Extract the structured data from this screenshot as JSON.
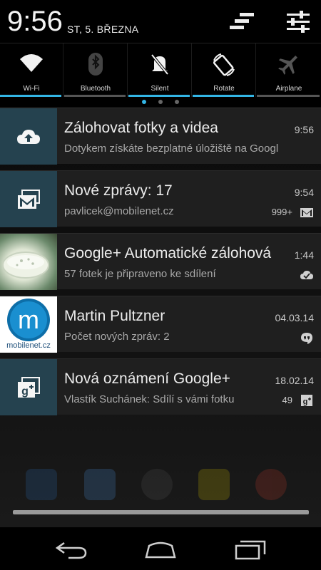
{
  "status": {
    "time": "9:56",
    "date": "ST, 5. BŘEZNA"
  },
  "quick_settings": [
    {
      "label": "Wi-Fi",
      "icon": "wifi-icon",
      "active": true
    },
    {
      "label": "Bluetooth",
      "icon": "bluetooth-icon",
      "active": false
    },
    {
      "label": "Silent",
      "icon": "silent-icon",
      "active": true
    },
    {
      "label": "Rotate",
      "icon": "rotate-icon",
      "active": true
    },
    {
      "label": "Airplane",
      "icon": "airplane-icon",
      "active": false
    }
  ],
  "pager": {
    "pages": 3,
    "active": 0
  },
  "notifications": [
    {
      "title": "Zálohovat fotky a videa",
      "subtitle": "Dotykem získáte bezplatné úložiště na Googl",
      "time": "9:56",
      "icon": "upload-cloud-icon"
    },
    {
      "title": "Nové zprávy: 17",
      "subtitle": "pavlicek@mobilenet.cz",
      "time": "9:54",
      "count": "999+",
      "icon": "gmail-icon"
    },
    {
      "title": "Google+ Automatické zálohová",
      "subtitle": "57 fotek je připraveno ke sdílení",
      "time": "1:44",
      "icon": "photo-thumbnail"
    },
    {
      "title": "Martin Pultzner",
      "subtitle": "Počet nových zpráv: 2",
      "time": "04.03.14",
      "icon": "mobilenet-avatar",
      "avatar_text": "mobilenet.cz"
    },
    {
      "title": "Nová oznámení Google+",
      "subtitle": "Vlastík Suchánek: Sdílí s vámi fotku",
      "time": "18.02.14",
      "count": "49",
      "icon": "google-plus-icon"
    }
  ],
  "colors": {
    "accent": "#33b5e5",
    "icon_bg": "#25424f",
    "card_bg": "#1f1f1f"
  },
  "nav": [
    "back-icon",
    "home-icon",
    "recents-icon"
  ]
}
